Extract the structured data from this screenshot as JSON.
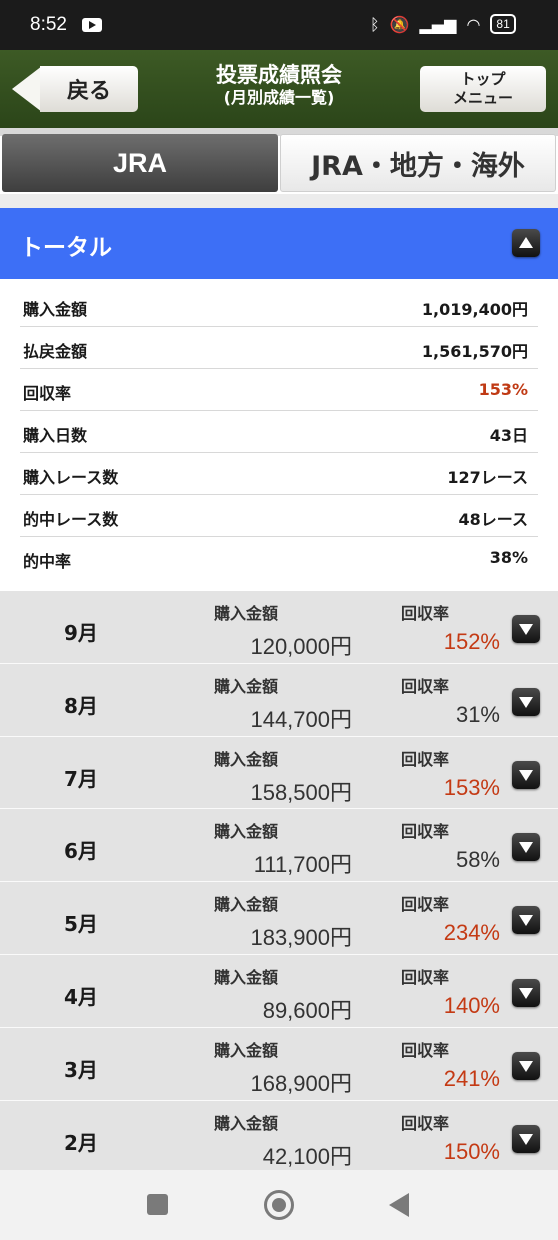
{
  "status_bar": {
    "time": "8:52",
    "battery": "81",
    "icons": [
      "youtube-icon",
      "bluetooth-icon",
      "mute-icon",
      "signal-icon",
      "wifi-icon",
      "battery-icon"
    ]
  },
  "header": {
    "back_label": "戻る",
    "title": "投票成績照会",
    "subtitle": "(月別成績一覧)",
    "top_menu_line1": "トップ",
    "top_menu_line2": "メニュー"
  },
  "tabs": [
    {
      "label": "JRA",
      "selected": true
    },
    {
      "label": "JRA・地方・海外",
      "selected": false
    }
  ],
  "total": {
    "title": "トータル",
    "rows": [
      {
        "label": "購入金額",
        "value": "1,019,400円"
      },
      {
        "label": "払戻金額",
        "value": "1,561,570円"
      },
      {
        "label": "回収率",
        "value": "153%",
        "highlight": true
      },
      {
        "label": "購入日数",
        "value": "43日"
      },
      {
        "label": "購入レース数",
        "value": "127レース"
      },
      {
        "label": "的中レース数",
        "value": "48レース"
      },
      {
        "label": "的中率",
        "value": "38%"
      }
    ]
  },
  "months": {
    "amount_label": "購入金額",
    "rate_label": "回収率",
    "rows": [
      {
        "month": "9月",
        "amount": "120,000円",
        "rate": "152%",
        "highlight": true
      },
      {
        "month": "8月",
        "amount": "144,700円",
        "rate": "31%",
        "highlight": false
      },
      {
        "month": "7月",
        "amount": "158,500円",
        "rate": "153%",
        "highlight": true
      },
      {
        "month": "6月",
        "amount": "111,700円",
        "rate": "58%",
        "highlight": false
      },
      {
        "month": "5月",
        "amount": "183,900円",
        "rate": "234%",
        "highlight": true
      },
      {
        "month": "4月",
        "amount": "89,600円",
        "rate": "140%",
        "highlight": true
      },
      {
        "month": "3月",
        "amount": "168,900円",
        "rate": "241%",
        "highlight": true
      },
      {
        "month": "2月",
        "amount": "42,100円",
        "rate": "150%",
        "highlight": true
      }
    ]
  },
  "colors": {
    "header_green": "#2b4519",
    "total_blue": "#3d6ff6",
    "highlight_red": "#c43a14",
    "month_row_bg": "#e3e3e3"
  }
}
